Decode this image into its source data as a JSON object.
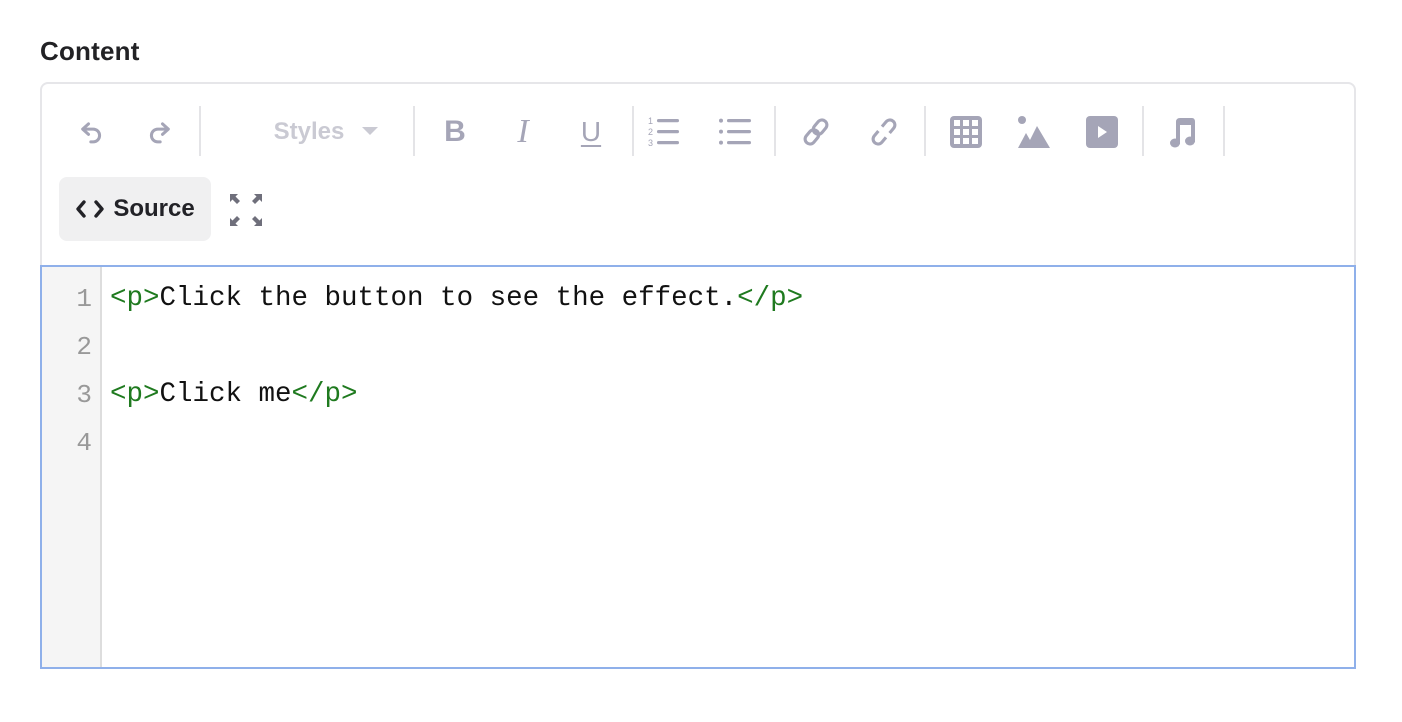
{
  "field": {
    "label": "Content"
  },
  "toolbar": {
    "undo": "undo",
    "redo": "redo",
    "styles_label": "Styles",
    "bold": "B",
    "italic": "I",
    "underline": "U",
    "source_label": "Source",
    "icon_color": "#a5a5b7",
    "disabled_color": "#cacad3"
  },
  "editor": {
    "mode": "source",
    "lines": [
      {
        "number": "1",
        "open_tag": "<p>",
        "text": "Click the button to see the effect.",
        "close_tag": "</p>"
      },
      {
        "number": "2",
        "open_tag": "",
        "text": "",
        "close_tag": ""
      },
      {
        "number": "3",
        "open_tag": "<p>",
        "text": "Click me",
        "close_tag": "</p>"
      },
      {
        "number": "4",
        "open_tag": "",
        "text": "",
        "close_tag": ""
      }
    ],
    "focus_border_color": "#8fb0ea",
    "tag_color": "#1f7a1f"
  }
}
